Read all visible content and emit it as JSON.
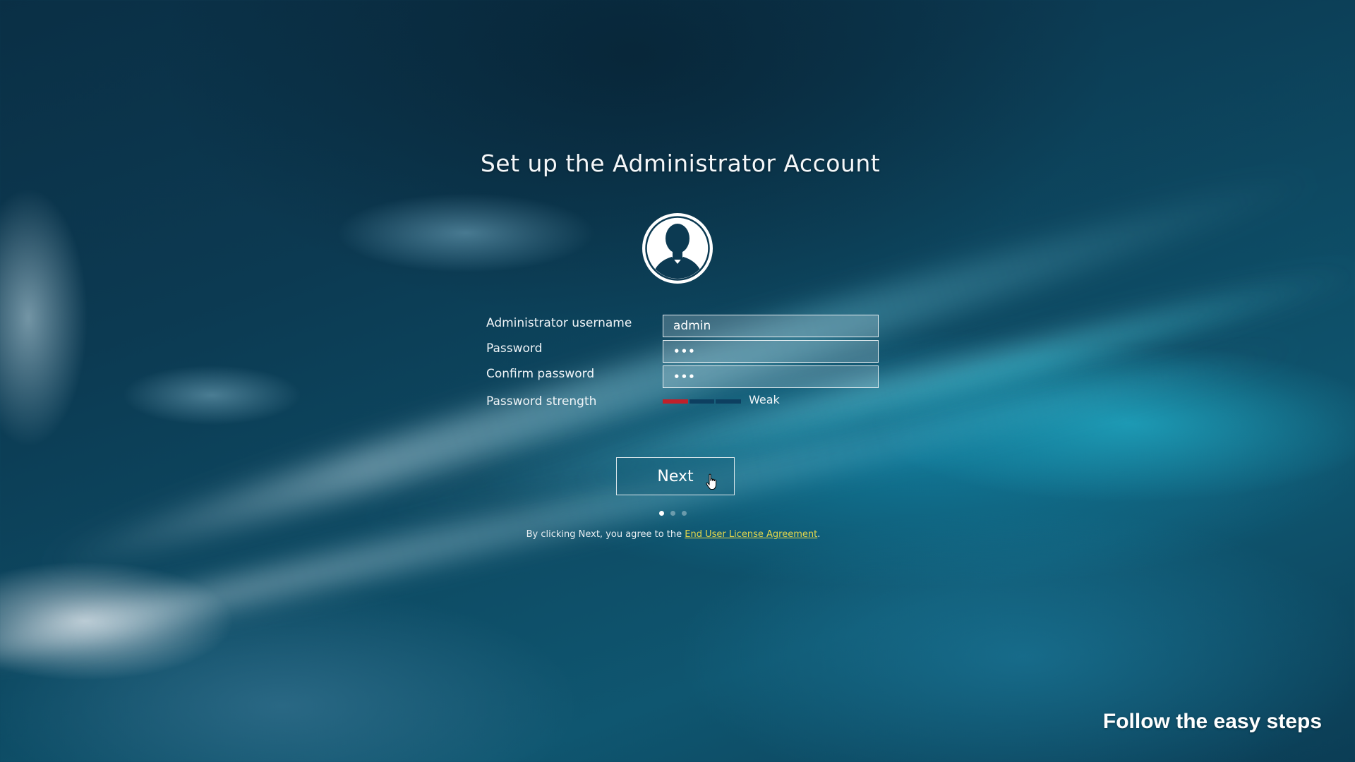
{
  "page": {
    "title": "Set up the Administrator Account",
    "tagline": "Follow the easy steps"
  },
  "avatar": {
    "icon": "user-silhouette-icon"
  },
  "form": {
    "username": {
      "label": "Administrator username",
      "value": "admin"
    },
    "password": {
      "label": "Password",
      "value": "•••"
    },
    "confirm_password": {
      "label": "Confirm password",
      "value": "•••"
    },
    "strength": {
      "label": "Password strength",
      "value": "Weak",
      "level": 1,
      "segments": 3,
      "color": "#c0202a"
    }
  },
  "actions": {
    "next_label": "Next"
  },
  "pager": {
    "steps": 3,
    "current": 1
  },
  "eula": {
    "prefix": "By clicking Next, you agree to the ",
    "link_text": "End User License Agreement",
    "suffix": "."
  },
  "colors": {
    "background": "#0d4a63",
    "link": "#e6d84a"
  }
}
